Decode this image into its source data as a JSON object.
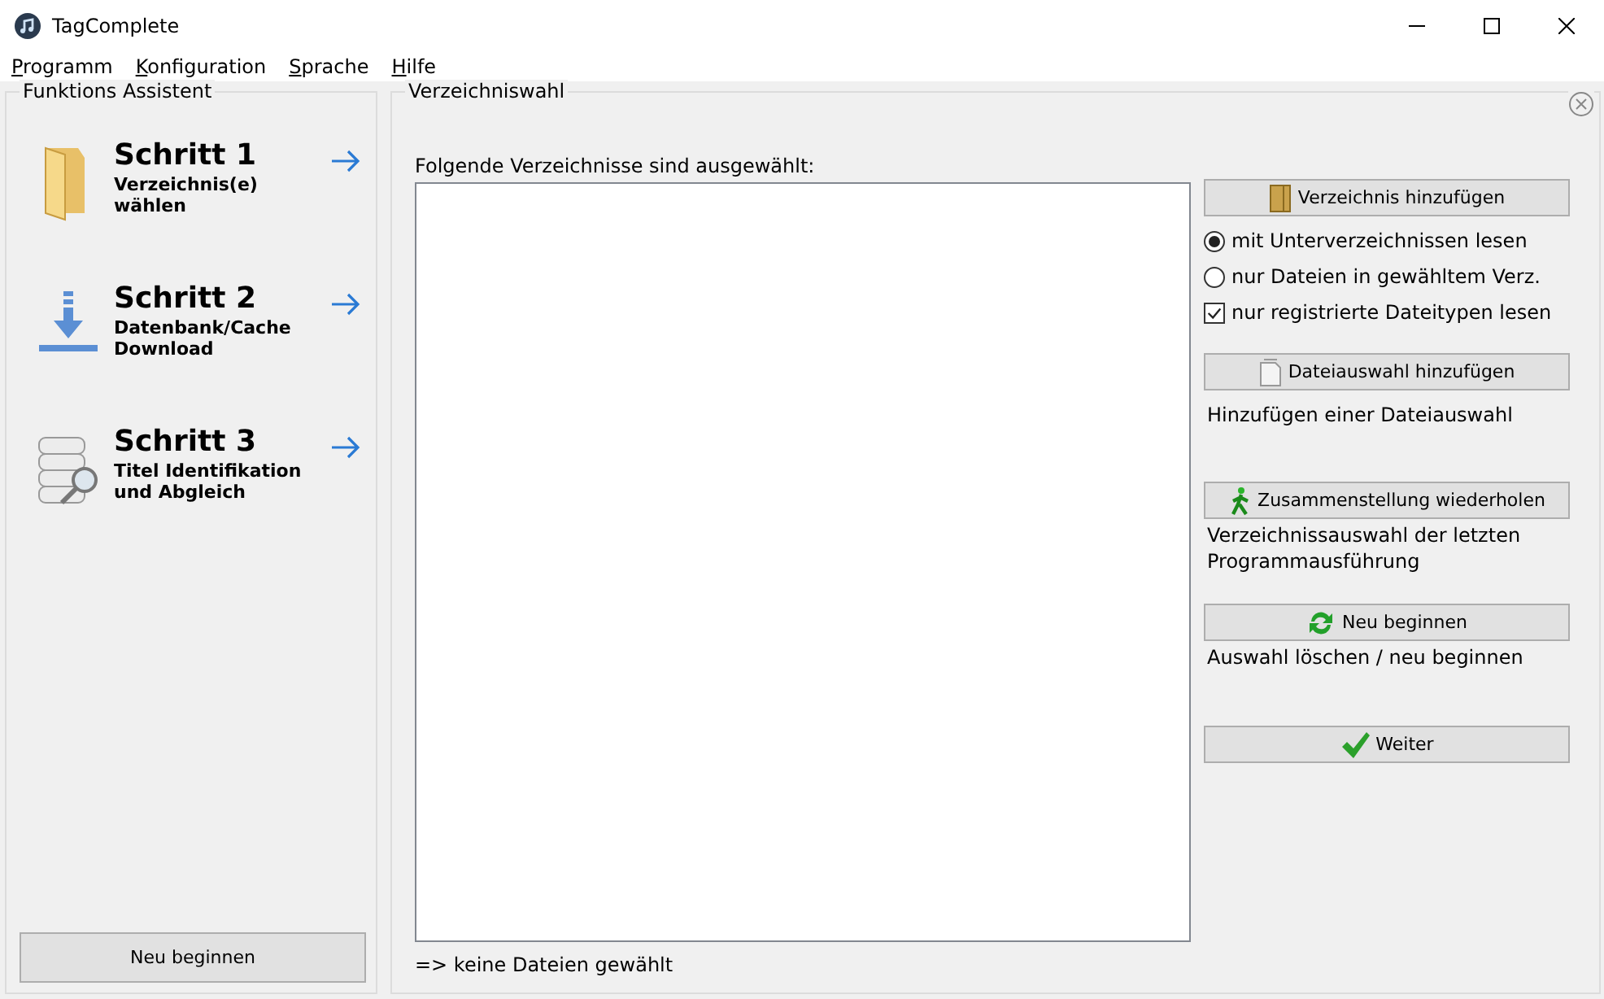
{
  "window": {
    "title": "TagComplete"
  },
  "menu": [
    "Programm",
    "Konfiguration",
    "Sprache",
    "Hilfe"
  ],
  "assistant": {
    "title": "Funktions Assistent",
    "steps": [
      {
        "kind": "folder",
        "title": "Schritt 1",
        "subtitle": "Verzeichnis(e) wählen"
      },
      {
        "kind": "download",
        "title": "Schritt 2",
        "subtitle": "Datenbank/Cache Download"
      },
      {
        "kind": "database",
        "title": "Schritt 3",
        "subtitle": "Titel Identifikation und Abgleich"
      }
    ],
    "button": "Neu beginnen"
  },
  "panel": {
    "title": "Verzeichniswahl",
    "list_label": "Folgende Verzeichnisse sind ausgewählt:",
    "status": "=> keine Dateien gewählt",
    "sections": [
      {
        "kind": "button",
        "label": "Verzeichnis hinzufügen"
      },
      {
        "kind": "radio",
        "label": "mit Unterverzeichnissen lesen",
        "selected": true
      },
      {
        "kind": "radio",
        "label": "nur Dateien in gewähltem Verz.",
        "selected": false
      },
      {
        "kind": "checkbox",
        "label": "nur registrierte Dateitypen lesen",
        "checked": true
      },
      {
        "kind": "button",
        "label": "Dateiauswahl hinzufügen"
      },
      {
        "kind": "note",
        "label": "Hinzufügen einer Dateiauswahl"
      },
      {
        "kind": "button",
        "label": "Zusammenstellung wiederholen"
      },
      {
        "kind": "note",
        "label": "Verzeichnissauswahl der letzten Programmausführung"
      },
      {
        "kind": "button",
        "label": "Neu beginnen"
      },
      {
        "kind": "note",
        "label": "Auswahl löschen / neu beginnen"
      },
      {
        "kind": "button",
        "label": "Weiter"
      }
    ]
  }
}
